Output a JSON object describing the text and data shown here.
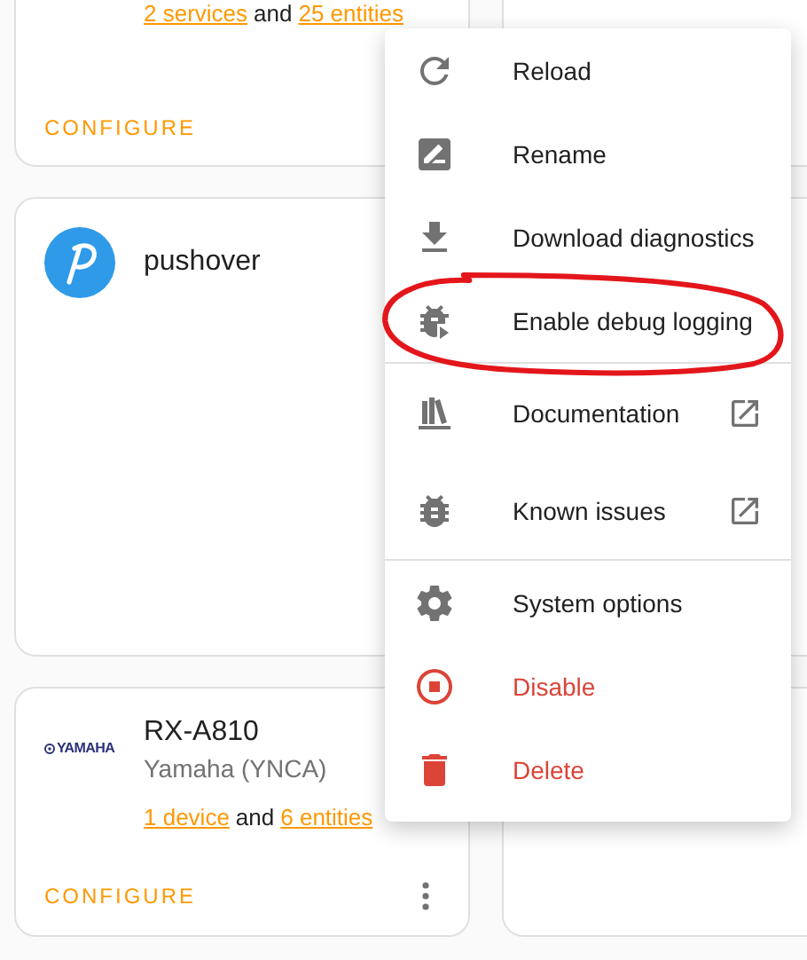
{
  "left_cards": [
    {
      "kind": "plain",
      "links": [
        {
          "text": "2 services",
          "kind": "link"
        },
        {
          "text": "and",
          "kind": "plain"
        },
        {
          "text": "25 entities",
          "kind": "link"
        }
      ],
      "action": "CONFIGURE"
    },
    {
      "kind": "pushover",
      "title": "pushover"
    },
    {
      "kind": "yamaha",
      "logo_text": "YAMAHA",
      "title": "RX-A810",
      "subtitle": "Yamaha (YNCA)",
      "links": [
        {
          "text": "1 device",
          "kind": "link"
        },
        {
          "text": "and",
          "kind": "plain"
        },
        {
          "text": "6 entities",
          "kind": "link"
        }
      ],
      "action": "CONFIGURE"
    }
  ],
  "menu": {
    "items": [
      {
        "label": "Reload",
        "kind": "reload",
        "external": false,
        "danger": false,
        "divider_after": false,
        "annotated": false
      },
      {
        "label": "Rename",
        "kind": "rename",
        "external": false,
        "danger": false,
        "divider_after": false,
        "annotated": false
      },
      {
        "label": "Download diagnostics",
        "kind": "download",
        "external": false,
        "danger": false,
        "divider_after": false,
        "annotated": false
      },
      {
        "label": "Enable debug logging",
        "kind": "debug",
        "external": false,
        "danger": false,
        "divider_after": true,
        "annotated": true
      },
      {
        "label": "Documentation",
        "kind": "docs",
        "external": true,
        "danger": false,
        "divider_after": false,
        "annotated": false
      },
      {
        "label": "Known issues",
        "kind": "issues",
        "external": true,
        "danger": false,
        "divider_after": true,
        "annotated": false
      },
      {
        "label": "System options",
        "kind": "options",
        "external": false,
        "danger": false,
        "divider_after": false,
        "annotated": false
      },
      {
        "label": "Disable",
        "kind": "disable",
        "external": false,
        "danger": true,
        "divider_after": false,
        "annotated": false
      },
      {
        "label": "Delete",
        "kind": "delete",
        "external": false,
        "danger": true,
        "divider_after": false,
        "annotated": false
      }
    ]
  }
}
